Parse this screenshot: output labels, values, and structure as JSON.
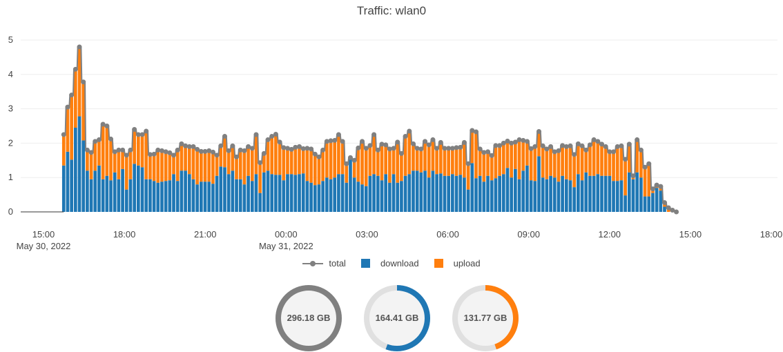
{
  "title": "Traffic: wlan0",
  "colors": {
    "total": "#808080",
    "download": "#1f77b4",
    "upload": "#ff7f0e",
    "track": "#e0e0e0",
    "gauge_face": "#f3f3f3"
  },
  "legend": [
    {
      "label": "total",
      "key": "total",
      "marker": "line"
    },
    {
      "label": "download",
      "key": "download",
      "marker": "box"
    },
    {
      "label": "upload",
      "key": "upload",
      "marker": "box"
    }
  ],
  "gauges": [
    {
      "label": "296.18 GB",
      "key": "total",
      "fraction": 1.0
    },
    {
      "label": "164.41 GB",
      "key": "download",
      "fraction": 0.555
    },
    {
      "label": "131.77 GB",
      "key": "upload",
      "fraction": 0.445
    }
  ],
  "chart_data": {
    "type": "bar",
    "stacked": true,
    "title": "Traffic: wlan0",
    "xlabel": "",
    "ylabel": "",
    "ylim": [
      0,
      5
    ],
    "yticks": [
      "0",
      "1",
      "2",
      "3",
      "4",
      "5"
    ],
    "xlim_hours": [
      15,
      42
    ],
    "xticks": [
      {
        "hour": 15,
        "label": "15:00",
        "sublabel": "May 30, 2022"
      },
      {
        "hour": 18,
        "label": "18:00",
        "sublabel": ""
      },
      {
        "hour": 21,
        "label": "21:00",
        "sublabel": ""
      },
      {
        "hour": 24,
        "label": "00:00",
        "sublabel": "May 31, 2022"
      },
      {
        "hour": 27,
        "label": "03:00",
        "sublabel": ""
      },
      {
        "hour": 30,
        "label": "06:00",
        "sublabel": ""
      },
      {
        "hour": 33,
        "label": "09:00",
        "sublabel": ""
      },
      {
        "hour": 36,
        "label": "12:00",
        "sublabel": ""
      },
      {
        "hour": 39,
        "label": "15:00",
        "sublabel": ""
      },
      {
        "hour": 42,
        "label": "18:00",
        "sublabel": ""
      }
    ],
    "grid": true,
    "legend_position": "bottom",
    "bar_width_hours": 0.12,
    "x_start_hour": 15.75,
    "x_step_hours": 0.1457,
    "series": [
      {
        "name": "download",
        "values": [
          1.35,
          1.75,
          1.52,
          2.45,
          2.78,
          2.08,
          1.2,
          0.95,
          1.2,
          1.35,
          0.95,
          1.05,
          0.92,
          1.15,
          0.95,
          1.25,
          0.65,
          0.95,
          1.4,
          1.35,
          1.3,
          0.95,
          0.95,
          0.9,
          0.85,
          0.88,
          0.9,
          0.92,
          1.1,
          0.9,
          1.2,
          1.2,
          1.1,
          0.95,
          0.8,
          0.88,
          0.88,
          0.88,
          0.82,
          1.05,
          1.32,
          1.3,
          1.1,
          1.2,
          0.95,
          0.95,
          0.8,
          1.05,
          0.9,
          1.1,
          0.55,
          1.15,
          1.2,
          1.1,
          1.08,
          1.08,
          0.92,
          1.1,
          1.1,
          1.08,
          1.1,
          1.12,
          0.9,
          0.85,
          0.78,
          0.8,
          0.9,
          1.0,
          0.95,
          1.0,
          1.1,
          1.1,
          0.85,
          1.58,
          1.0,
          0.88,
          0.8,
          0.75,
          1.05,
          1.1,
          1.05,
          0.92,
          1.1,
          0.85,
          1.1,
          0.85,
          0.9,
          1.05,
          1.1,
          1.2,
          1.2,
          1.15,
          1.2,
          1.0,
          1.2,
          1.1,
          1.12,
          1.05,
          1.05,
          1.1,
          1.05,
          1.08,
          1.0,
          0.65,
          1.42,
          0.98,
          1.05,
          0.88,
          1.05,
          0.92,
          0.98,
          1.05,
          1.1,
          1.28,
          1.0,
          1.25,
          0.95,
          1.2,
          1.35,
          0.92,
          0.9,
          1.62,
          1.0,
          0.95,
          1.05,
          1.0,
          0.88,
          1.05,
          0.95,
          0.92,
          0.72,
          1.1,
          0.92,
          1.15,
          1.05,
          1.05,
          1.1,
          1.05,
          1.05,
          1.05,
          0.9,
          0.9,
          0.92,
          0.48,
          1.15,
          0.95,
          1.15,
          1.0,
          0.45,
          0.45,
          0.55,
          0.7,
          0.62,
          0.15,
          0.0,
          0.0,
          0.0
        ]
      },
      {
        "name": "upload",
        "values": [
          0.9,
          1.3,
          1.88,
          1.7,
          2.02,
          1.7,
          0.6,
          0.78,
          0.85,
          0.75,
          1.6,
          1.45,
          1.2,
          0.6,
          0.85,
          0.55,
          1.0,
          0.85,
          1.0,
          0.9,
          0.95,
          1.4,
          0.72,
          0.78,
          0.95,
          0.9,
          0.85,
          0.8,
          0.55,
          0.9,
          0.78,
          0.72,
          0.8,
          0.95,
          1.02,
          0.88,
          0.88,
          0.9,
          0.92,
          0.6,
          0.6,
          0.9,
          0.68,
          0.72,
          0.65,
          0.85,
          0.98,
          0.85,
          0.95,
          1.15,
          0.88,
          0.55,
          0.9,
          1.1,
          1.18,
          0.95,
          0.95,
          0.75,
          0.72,
          0.8,
          0.8,
          0.72,
          0.95,
          0.98,
          0.9,
          0.8,
          0.9,
          1.05,
          1.12,
          1.08,
          1.15,
          0.95,
          0.55,
          0.0,
          0.5,
          0.98,
          1.25,
          1.1,
          0.88,
          1.15,
          0.75,
          1.05,
          0.85,
          0.98,
          0.75,
          1.18,
          0.8,
          1.15,
          1.25,
          0.78,
          0.65,
          0.68,
          0.85,
          0.95,
          0.9,
          0.75,
          0.9,
          0.8,
          0.8,
          0.75,
          0.82,
          0.8,
          1.02,
          0.75,
          0.95,
          1.35,
          0.78,
          0.85,
          0.7,
          0.72,
          0.95,
          0.88,
          0.9,
          0.78,
          1.0,
          0.78,
          1.15,
          0.88,
          0.7,
          0.92,
          1.0,
          0.72,
          0.92,
          0.88,
          0.85,
          0.75,
          0.9,
          0.88,
          0.95,
          1.0,
          0.95,
          0.88,
          1.0,
          0.65,
          0.9,
          1.05,
          0.95,
          0.92,
          0.85,
          0.7,
          0.85,
          1.0,
          1.0,
          1.05,
          0.82,
          0.1,
          0.95,
          0.8,
          0.85,
          0.95,
          0.12,
          0.08,
          0.12,
          0.12,
          0.12,
          0.05,
          0.0,
          0.0,
          0.0
        ]
      }
    ]
  }
}
